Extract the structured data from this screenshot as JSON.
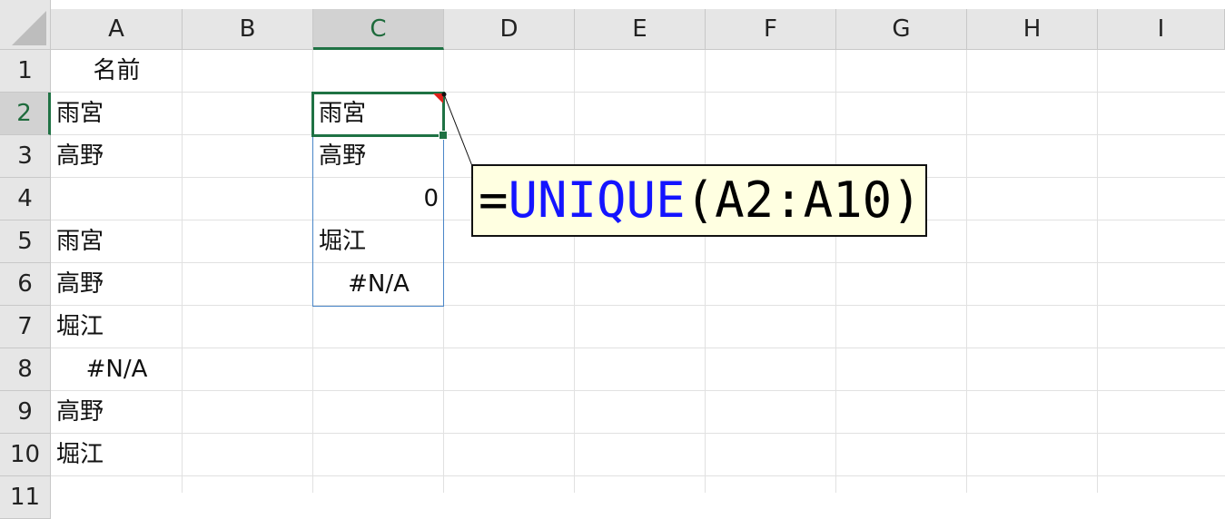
{
  "columns": [
    "A",
    "B",
    "C",
    "D",
    "E",
    "F",
    "G",
    "H",
    "I"
  ],
  "rows": [
    "1",
    "2",
    "3",
    "4",
    "5",
    "6",
    "7",
    "8",
    "9",
    "10",
    "11"
  ],
  "column_a": {
    "r1": "名前",
    "r2": "雨宮",
    "r3": "高野",
    "r4": "",
    "r5": "雨宮",
    "r6": "高野",
    "r7": "堀江",
    "r8": "#N/A",
    "r9": "高野",
    "r10": "堀江"
  },
  "column_c": {
    "r2": "雨宮",
    "r3": "高野",
    "r4": "0",
    "r5": "堀江",
    "r6": "#N/A"
  },
  "selected_cell": "C2",
  "formula": {
    "prefix": "=",
    "function": "UNIQUE",
    "args": "(A2:A10)"
  },
  "colors": {
    "selection": "#1f7244",
    "spill_border": "#4a86c8",
    "callout_bg": "#ffffe1",
    "function_color": "#1414ff",
    "comment_marker": "#e0201a"
  }
}
